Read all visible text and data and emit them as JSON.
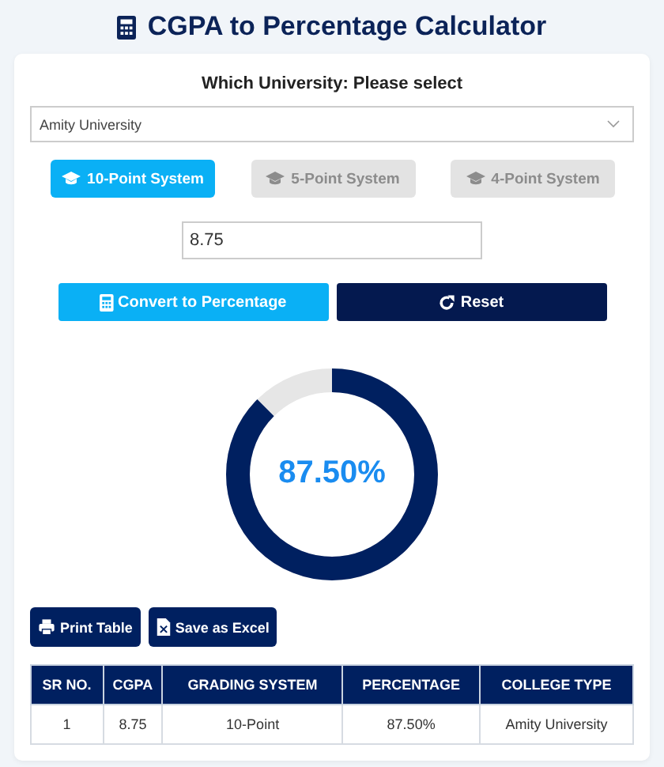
{
  "title": "CGPA to Percentage Calculator",
  "university": {
    "label": "Which University: Please select",
    "value": "Amity University"
  },
  "systems": [
    {
      "label": "10-Point System",
      "selected": true
    },
    {
      "label": "5-Point System",
      "selected": false
    },
    {
      "label": "4-Point System",
      "selected": false
    }
  ],
  "cgpa_input": {
    "value": "8.75"
  },
  "actions": [
    {
      "kind": "convert",
      "label": "Convert to Percentage"
    },
    {
      "kind": "reset",
      "label": "Reset"
    }
  ],
  "gauge": {
    "label": "87.50%",
    "level": 0.875
  },
  "export_buttons": [
    {
      "kind": "print",
      "label": "Print Table"
    },
    {
      "kind": "excel",
      "label": "Save as Excel"
    }
  ],
  "table": {
    "columns": [
      "SR NO.",
      "CGPA",
      "GRADING SYSTEM",
      "PERCENTAGE",
      "COLLEGE TYPE"
    ],
    "rows": [
      [
        "1",
        "8.75",
        "10-Point",
        "87.50%",
        "Amity University"
      ]
    ]
  }
}
